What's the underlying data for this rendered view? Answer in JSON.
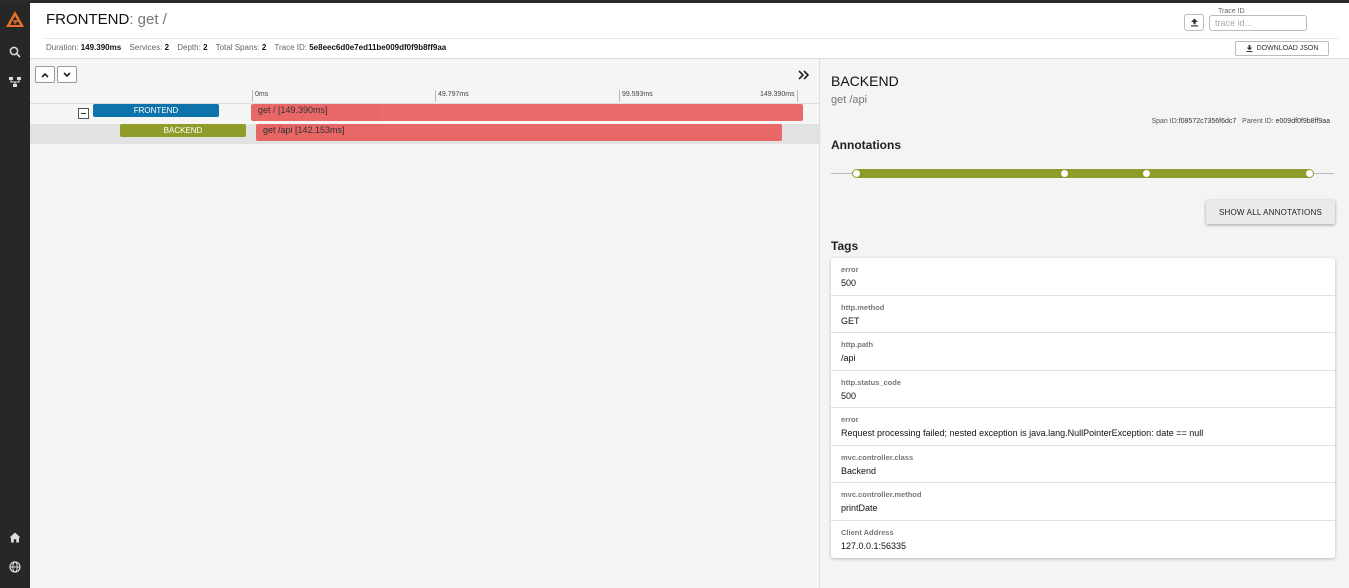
{
  "colors": {
    "frontend": "#0f73ab",
    "backend": "#8f9c2a",
    "span_bar": "#e85c5c",
    "sidebar": "#272727",
    "logo": "#e8702a"
  },
  "sidebar": {
    "items": [
      {
        "icon": "search-icon"
      },
      {
        "icon": "dependencies-icon"
      },
      {
        "icon": "home-icon"
      },
      {
        "icon": "globe-icon"
      }
    ]
  },
  "header": {
    "service": "FRONTEND",
    "span_name": ": get /",
    "meta": {
      "duration_label": "Duration:",
      "duration": "149.390ms",
      "services_label": "Services:",
      "services": "2",
      "depth_label": "Depth:",
      "depth": "2",
      "total_spans_label": "Total Spans:",
      "total_spans": "2",
      "trace_id_label": "Trace ID:",
      "trace_id": "5e8eec6d0e7ed11be009df0f9b8ff9aa"
    },
    "trace_id_field_label": "Trace ID",
    "trace_id_placeholder": "trace id...",
    "download_label": "DOWNLOAD JSON"
  },
  "timeline": {
    "ticks": [
      "0ms",
      "49.797ms",
      "99.593ms",
      "149.390ms"
    ],
    "spans": [
      {
        "service": "FRONTEND",
        "label": "get / [149.390ms]",
        "color": "frontend"
      },
      {
        "service": "BACKEND",
        "label": "get /api [142.153ms]",
        "color": "backend"
      }
    ]
  },
  "detail": {
    "service": "BACKEND",
    "span_name": "get /api",
    "span_id_label": "Span ID:",
    "span_id": "f08572c7356f6dc7",
    "parent_id_label": "Parent ID:",
    "parent_id": "e009df0f9b8ff9aa",
    "annotations_heading": "Annotations",
    "show_all_label": "SHOW ALL ANNOTATIONS",
    "tags_heading": "Tags",
    "tags": [
      {
        "key": "error",
        "value": "500"
      },
      {
        "key": "http.method",
        "value": "GET"
      },
      {
        "key": "http.path",
        "value": "/api"
      },
      {
        "key": "http.status_code",
        "value": "500"
      },
      {
        "key": "error",
        "value": "Request processing failed; nested exception is java.lang.NullPointerException: date == null"
      },
      {
        "key": "mvc.controller.class",
        "value": "Backend"
      },
      {
        "key": "mvc.controller.method",
        "value": "printDate"
      },
      {
        "key": "Client Address",
        "value": "127.0.0.1:56335"
      }
    ]
  }
}
